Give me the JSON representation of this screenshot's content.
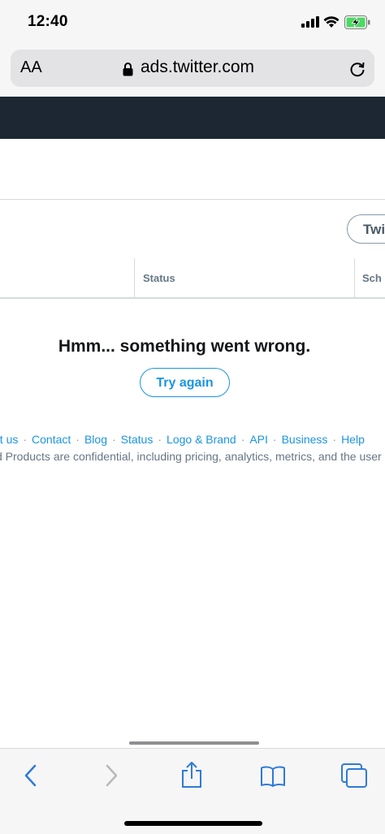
{
  "status_bar": {
    "time": "12:40",
    "icons": [
      "signal-icon",
      "wifi-icon",
      "battery-charging-icon"
    ]
  },
  "browser": {
    "aa": "AA",
    "url": "ads.twitter.com"
  },
  "tabs_partial": {
    "right_button": "Twi"
  },
  "table": {
    "columns": [
      "Status",
      "Sch"
    ]
  },
  "error": {
    "message": "Hmm... something went wrong.",
    "retry_label": "Try again"
  },
  "footer": {
    "links": [
      "ut us",
      "Contact",
      "Blog",
      "Status",
      "Logo & Brand",
      "API",
      "Business",
      "Help"
    ],
    "separator": "·",
    "note": "d Products are confidential, including pricing, analytics, metrics, and the user"
  },
  "toolbar": {
    "icons": [
      "back-icon",
      "forward-icon",
      "share-icon",
      "bookmarks-icon",
      "tabs-icon"
    ]
  },
  "colors": {
    "accent": "#1b95e0",
    "header": "#1c2733",
    "muted": "#657786"
  }
}
